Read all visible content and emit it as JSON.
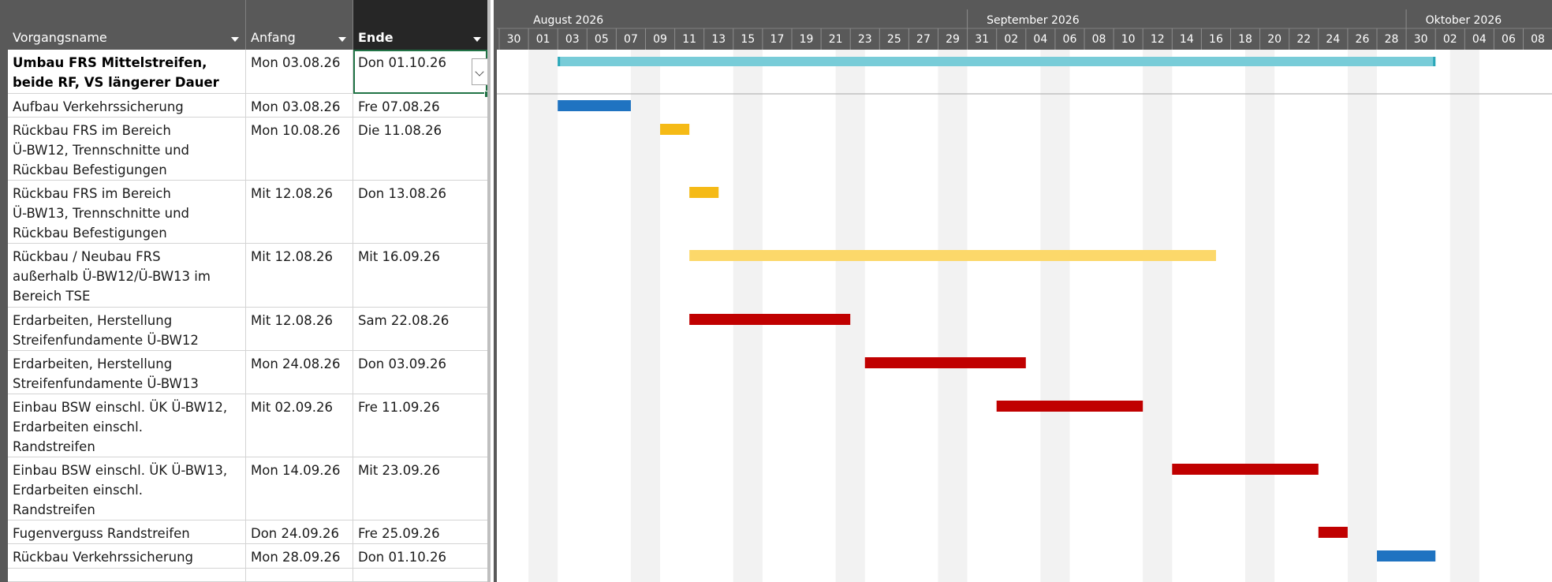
{
  "columns": {
    "name": "Vorgangsname",
    "start": "Anfang",
    "end": "Ende"
  },
  "timeline": {
    "months": [
      "August 2026",
      "September 2026",
      "Oktober 2026"
    ],
    "days": [
      "30",
      "01",
      "03",
      "05",
      "07",
      "09",
      "11",
      "13",
      "15",
      "17",
      "19",
      "21",
      "23",
      "25",
      "27",
      "29",
      "31",
      "02",
      "04",
      "06",
      "08",
      "10",
      "12",
      "14",
      "16",
      "18",
      "20",
      "22",
      "24",
      "26",
      "28",
      "30",
      "02",
      "04",
      "06",
      "08"
    ]
  },
  "tasks": [
    {
      "name": "Umbau FRS Mittelstreifen,\nbeide RF, VS längerer Dauer",
      "start": "Mon 03.08.26",
      "end": "Don 01.10.26",
      "summary": true,
      "bar_color": "#78CCD8"
    },
    {
      "name": "Aufbau Verkehrssicherung",
      "start": "Mon 03.08.26",
      "end": "Fre 07.08.26",
      "summary": false,
      "bar_color": "#1F73C1"
    },
    {
      "name": "Rückbau FRS im Bereich\nÜ-BW12, Trennschnitte und\nRückbau Befestigungen",
      "start": "Mon 10.08.26",
      "end": "Die 11.08.26",
      "summary": false,
      "bar_color": "#F5BA16"
    },
    {
      "name": "Rückbau FRS im Bereich\nÜ-BW13, Trennschnitte und\nRückbau Befestigungen",
      "start": "Mit 12.08.26",
      "end": "Don 13.08.26",
      "summary": false,
      "bar_color": "#F5BA16"
    },
    {
      "name": "Rückbau / Neubau FRS\naußerhalb Ü-BW12/Ü-BW13 im\nBereich TSE",
      "start": "Mit 12.08.26",
      "end": "Mit 16.09.26",
      "summary": false,
      "bar_color": "#FCD86A"
    },
    {
      "name": "Erdarbeiten, Herstellung\nStreifenfundamente Ü-BW12",
      "start": "Mit 12.08.26",
      "end": "Sam 22.08.26",
      "summary": false,
      "bar_color": "#C00000"
    },
    {
      "name": "Erdarbeiten, Herstellung\nStreifenfundamente Ü-BW13",
      "start": "Mon 24.08.26",
      "end": "Don 03.09.26",
      "summary": false,
      "bar_color": "#C00000"
    },
    {
      "name": "Einbau BSW einschl. ÜK Ü-BW12,\nErdarbeiten einschl.\nRandstreifen",
      "start": "Mit 02.09.26",
      "end": "Fre 11.09.26",
      "summary": false,
      "bar_color": "#C00000"
    },
    {
      "name": "Einbau BSW einschl. ÜK Ü-BW13,\nErdarbeiten einschl.\nRandstreifen",
      "start": "Mon 14.09.26",
      "end": "Mit 23.09.26",
      "summary": false,
      "bar_color": "#C00000"
    },
    {
      "name": "Fugenverguss Randstreifen",
      "start": "Don 24.09.26",
      "end": "Fre 25.09.26",
      "summary": false,
      "bar_color": "#C00000"
    },
    {
      "name": "Rückbau Verkehrssicherung",
      "start": "Mon 28.09.26",
      "end": "Don 01.10.26",
      "summary": false,
      "bar_color": "#1F73C1"
    }
  ],
  "colors": {
    "header_bg": "#595959",
    "header_active_bg": "#262626",
    "selection": "#217346",
    "weekend_shade": "#F2F2F2"
  }
}
